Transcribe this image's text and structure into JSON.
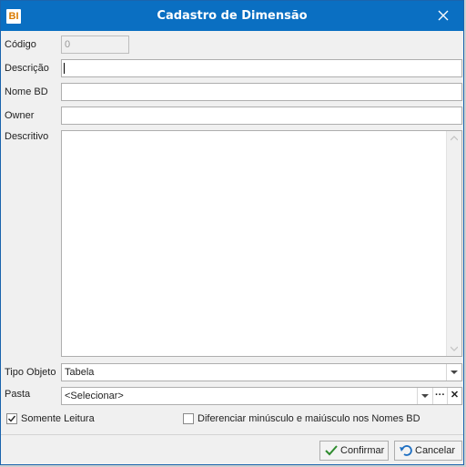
{
  "window": {
    "title": "Cadastro de Dimensão",
    "app_icon_text": "BI"
  },
  "form": {
    "codigo": {
      "label": "Código",
      "value": "0"
    },
    "descricao": {
      "label": "Descrição",
      "value": ""
    },
    "nome_bd": {
      "label": "Nome BD",
      "value": ""
    },
    "owner": {
      "label": "Owner",
      "value": ""
    },
    "descritivo": {
      "label": "Descritivo",
      "value": ""
    },
    "tipo_objeto": {
      "label": "Tipo Objeto",
      "value": "Tabela"
    },
    "pasta": {
      "label": "Pasta",
      "value": "<Selecionar>",
      "ellipsis": "···",
      "clear": "✕"
    },
    "somente_leitura": {
      "label": "Somente Leitura",
      "checked": true
    },
    "diferenciar": {
      "label": "Diferenciar minúsculo e maiúsculo nos Nomes BD",
      "checked": false
    }
  },
  "buttons": {
    "confirmar": "Confirmar",
    "cancelar": "Cancelar"
  },
  "colors": {
    "titlebar": "#0a6fc2",
    "confirm_check": "#2e8b2e",
    "cancel_arrow": "#1e6fc2"
  }
}
